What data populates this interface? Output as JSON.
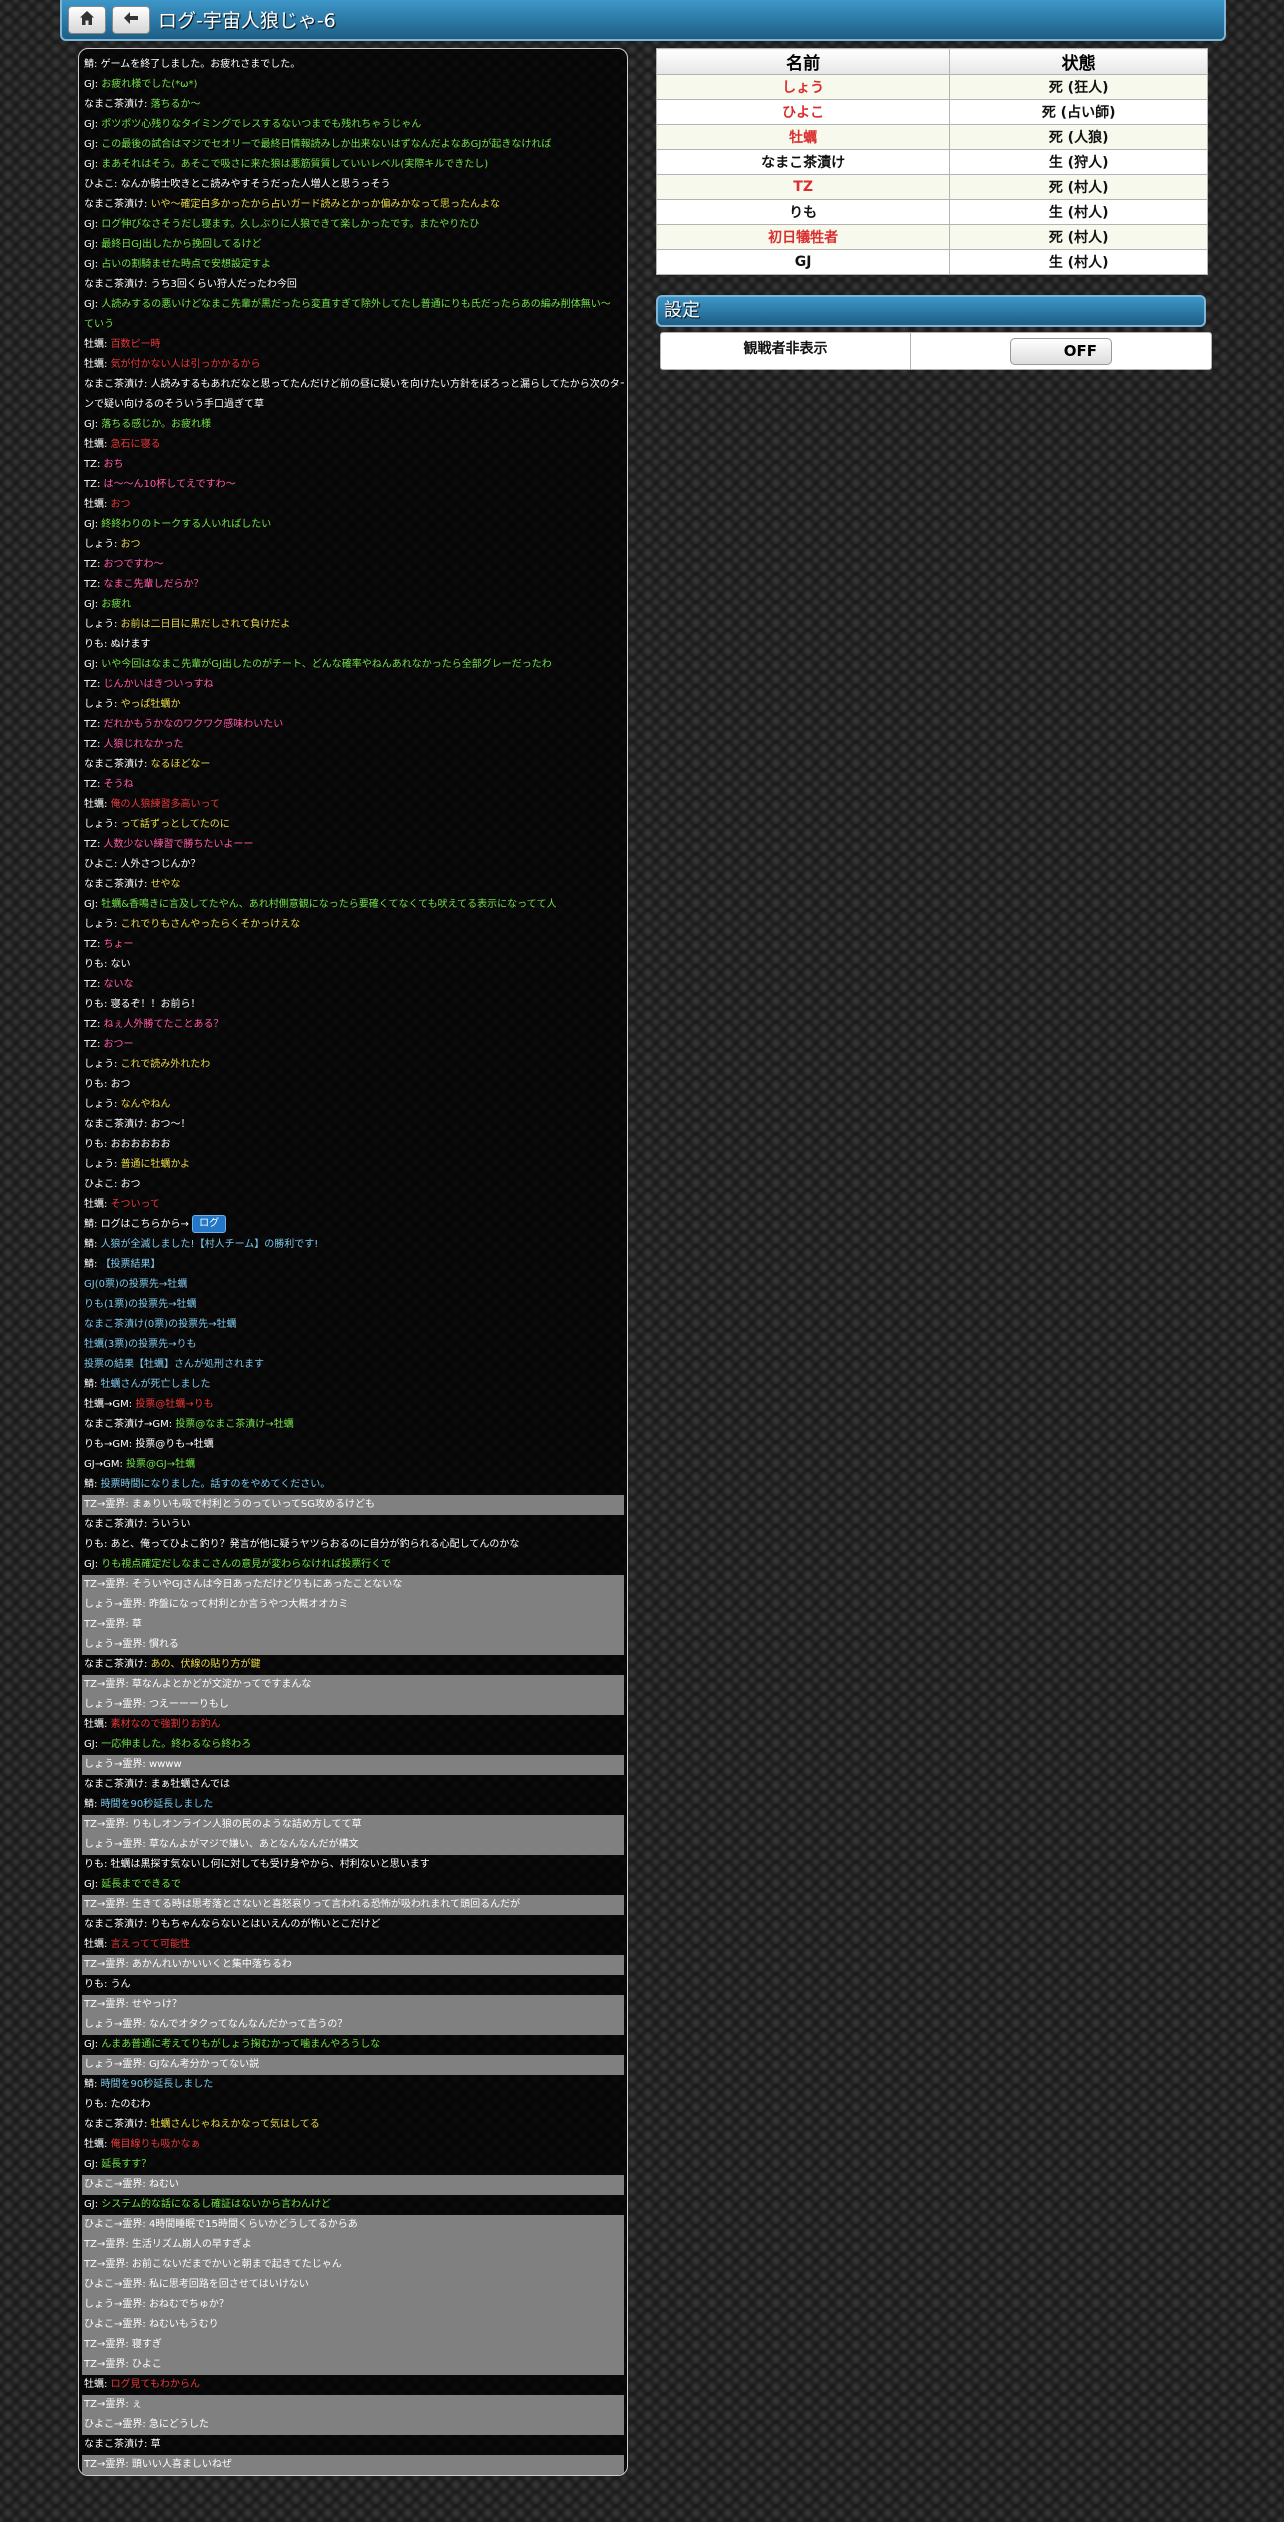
{
  "header": {
    "title": "ログ-宇宙人狼じゃ-6",
    "home_icon": "home-icon",
    "back_icon": "back-arrow-icon"
  },
  "status": {
    "columns": [
      "名前",
      "状態"
    ],
    "rows": [
      {
        "name": "しょう",
        "state": "死 (狂人)",
        "red": true
      },
      {
        "name": "ひよこ",
        "state": "死 (占い師)",
        "red": true
      },
      {
        "name": "牡蠣",
        "state": "死 (人狼)",
        "red": true
      },
      {
        "name": "なまこ茶漬け",
        "state": "生 (狩人)",
        "red": false
      },
      {
        "name": "TZ",
        "state": "死 (村人)",
        "red": true
      },
      {
        "name": "りも",
        "state": "生 (村人)",
        "red": false
      },
      {
        "name": "初日犠牲者",
        "state": "死 (村人)",
        "red": true
      },
      {
        "name": "GJ",
        "state": "生 (村人)",
        "red": false
      }
    ]
  },
  "settings": {
    "title": "設定",
    "label": "観戦者非表示",
    "toggle": "OFF"
  },
  "log_button": "ログ",
  "log": [
    {
      "s": "鯖: ",
      "t": "ゲームを終了しました。お疲れさまでした。",
      "c": "w"
    },
    {
      "s": "GJ: ",
      "t": "お疲れ様でした(*ω*)",
      "c": "g"
    },
    {
      "s": "なまこ茶漬け: ",
      "t": "落ちるか～",
      "c": "g"
    },
    {
      "s": "GJ: ",
      "t": "ポツポツ心残りなタイミングでレスするないつまでも残れちゃうじゃん",
      "c": "g"
    },
    {
      "s": "GJ: ",
      "t": "この最後の試合はマジでセオリーで最終日情報読みしか出来ないはずなんだよなあGJが起きなければ",
      "c": "g"
    },
    {
      "s": "GJ: ",
      "t": "まあそれはそう。あそこで吸さに来た狼は悪筋質質していいレベル(実際キルできたし)",
      "c": "g"
    },
    {
      "s": "ひよこ: ",
      "t": "なんか騎士吹きとこ読みやすそうだった人増人と思うっそう",
      "c": "w"
    },
    {
      "s": "なまこ茶漬け: ",
      "t": "いや～確定白多かったから占いガード読みとかっか偏みかなって思ったんよな",
      "c": "y"
    },
    {
      "s": "GJ: ",
      "t": "ログ伸びなさそうだし寝ます。久しぶりに人狼できて楽しかったです。またやりたひ",
      "c": "g"
    },
    {
      "s": "GJ: ",
      "t": "最終日GJ出したから挽回してるけど",
      "c": "g"
    },
    {
      "s": "GJ: ",
      "t": "占いの割騎ませた時点で安想設定すよ",
      "c": "g"
    },
    {
      "s": "なまこ茶漬け: ",
      "t": "うち3回くらい狩人だったわ今回",
      "c": "w"
    },
    {
      "s": "GJ: ",
      "t": "人読みするの悪いけどなまこ先輩が黒だったら変直すぎて除外してたし普通にりも氏だったらあの編み削体無い～",
      "c": "g"
    },
    {
      "s": "",
      "t": "ていう",
      "c": "g"
    },
    {
      "s": "牡蠣: ",
      "t": "百数ピー時",
      "c": "r"
    },
    {
      "s": "牡蠣: ",
      "t": "気が付かない人は引っかかるから",
      "c": "r"
    },
    {
      "s": "なまこ茶漬け: ",
      "t": "人読みするもあれだなと思ってたんだけど前の昼に疑いを向けたい方針をぼろっと漏らしてたから次のター",
      "c": "w"
    },
    {
      "s": "",
      "t": "ンで疑い向けるのそういう手口過ぎて草",
      "c": "w"
    },
    {
      "s": "GJ: ",
      "t": "落ちる感じか。お疲れ様",
      "c": "g"
    },
    {
      "s": "牡蠣: ",
      "t": "急石に寝る",
      "c": "r"
    },
    {
      "s": "TZ: ",
      "t": "おち",
      "c": "p"
    },
    {
      "s": "TZ: ",
      "t": "は～～ん10杯してえですわ～",
      "c": "p"
    },
    {
      "s": "牡蠣: ",
      "t": "おつ",
      "c": "r"
    },
    {
      "s": "GJ: ",
      "t": "終終わりのトークする人いればしたい",
      "c": "g"
    },
    {
      "s": "しょう: ",
      "t": "おつ",
      "c": "y"
    },
    {
      "s": "TZ: ",
      "t": "おつですわ～",
      "c": "p"
    },
    {
      "s": "TZ: ",
      "t": "なまこ先輩しだらか？",
      "c": "p"
    },
    {
      "s": "GJ: ",
      "t": "お疲れ",
      "c": "g"
    },
    {
      "s": "しょう: ",
      "t": "お前は二日目に黒だしされて負けだよ",
      "c": "y"
    },
    {
      "s": "りも: ",
      "t": "ぬけます",
      "c": "w"
    },
    {
      "s": "GJ: ",
      "t": "いや今回はなまこ先輩がGJ出したのがチート、どんな確率やねんあれなかったら全部グレーだったわ",
      "c": "g"
    },
    {
      "s": "TZ: ",
      "t": "じんかいはきついっすね",
      "c": "p"
    },
    {
      "s": "しょう: ",
      "t": "やっぱ牡蠣か",
      "c": "y"
    },
    {
      "s": "TZ: ",
      "t": "だれかもうかなのワクワク感味わいたい",
      "c": "p"
    },
    {
      "s": "TZ: ",
      "t": "人狼じれなかった",
      "c": "p"
    },
    {
      "s": "なまこ茶漬け: ",
      "t": "なるほどなー",
      "c": "y"
    },
    {
      "s": "TZ: ",
      "t": "そうね",
      "c": "p"
    },
    {
      "s": "牡蠣: ",
      "t": "俺の人狼練習多高いって",
      "c": "r"
    },
    {
      "s": "しょう: ",
      "t": "って話ずっとしてたのに",
      "c": "y"
    },
    {
      "s": "TZ: ",
      "t": "人数少ない練習で勝ちたいよーー",
      "c": "p"
    },
    {
      "s": "ひよこ: ",
      "t": "人外さつじんか？",
      "c": "w"
    },
    {
      "s": "なまこ茶漬け: ",
      "t": "せやな",
      "c": "y"
    },
    {
      "s": "GJ: ",
      "t": "牡蠣&香鳴きに言及してたやん、あれ村側意観になったら要確くてなくても吠えてる表示になってて人",
      "c": "g"
    },
    {
      "s": "しょう: ",
      "t": "これでりもさんやったらくそかっけえな",
      "c": "y"
    },
    {
      "s": "TZ: ",
      "t": "ちょー",
      "c": "p"
    },
    {
      "s": "りも: ",
      "t": "ない",
      "c": "w"
    },
    {
      "s": "TZ: ",
      "t": "ないな",
      "c": "p"
    },
    {
      "s": "りも: ",
      "t": "寝るぞ！！お前ら！",
      "c": "w"
    },
    {
      "s": "TZ: ",
      "t": "ねぇ人外勝てたことある？",
      "c": "p"
    },
    {
      "s": "TZ: ",
      "t": "おつー",
      "c": "p"
    },
    {
      "s": "しょう: ",
      "t": "これで読み外れたわ",
      "c": "y"
    },
    {
      "s": "りも: ",
      "t": "おつ",
      "c": "w"
    },
    {
      "s": "しょう: ",
      "t": "なんやねん",
      "c": "y"
    },
    {
      "s": "なまこ茶漬け: ",
      "t": "おつ～！",
      "c": "w"
    },
    {
      "s": "りも: ",
      "t": "おおおおおお",
      "c": "w"
    },
    {
      "s": "しょう: ",
      "t": "普通に牡蠣かよ",
      "c": "y"
    },
    {
      "s": "ひよこ: ",
      "t": "おつ",
      "c": "w"
    },
    {
      "s": "牡蠣: ",
      "t": "そついって",
      "c": "r"
    },
    {
      "s": "鯖: ",
      "t": "ログはこちらから→",
      "c": "w",
      "btn": true
    },
    {
      "s": "鯖: ",
      "t": "人狼が全滅しました!【村人チーム】の勝利です!",
      "c": "b"
    },
    {
      "s": "鯖: ",
      "t": "【投票結果】",
      "c": "b"
    },
    {
      "s": "",
      "t": "GJ(0票)の投票先→牡蠣",
      "c": "b"
    },
    {
      "s": "",
      "t": "りも(1票)の投票先→牡蠣",
      "c": "b"
    },
    {
      "s": "",
      "t": "なまこ茶漬け(0票)の投票先→牡蠣",
      "c": "b"
    },
    {
      "s": "",
      "t": "牡蠣(3票)の投票先→りも",
      "c": "b"
    },
    {
      "s": "",
      "t": "投票の結果【牡蠣】さんが処刑されます",
      "c": "b"
    },
    {
      "s": "鯖: ",
      "t": "牡蠣さんが死亡しました",
      "c": "b"
    },
    {
      "s": "牡蠣→GM: ",
      "t": "投票@牡蠣→りも",
      "c": "r"
    },
    {
      "s": "なまこ茶漬け→GM: ",
      "t": "投票@なまこ茶漬け→牡蠣",
      "c": "g"
    },
    {
      "s": "りも→GM: ",
      "t": "投票@りも→牡蠣",
      "c": "w"
    },
    {
      "s": "GJ→GM: ",
      "t": "投票@GJ→牡蠣",
      "c": "g"
    },
    {
      "s": "鯖: ",
      "t": "投票時間になりました。話すのをやめてください。",
      "c": "b"
    },
    {
      "s": "TZ→霊界: ",
      "t": "まぁりいも吸で村利とうのっていってSG攻めるけども",
      "c": "w",
      "grey": true
    },
    {
      "s": "なまこ茶漬け: ",
      "t": "ういうい",
      "c": "w"
    },
    {
      "s": "りも: ",
      "t": "あと、俺ってひよこ釣り？発言が他に疑うヤツらおるのに自分が釣られる心配してんのかな",
      "c": "w"
    },
    {
      "s": "GJ: ",
      "t": "りも視点確定だしなまこさんの意見が変わらなければ投票行くで",
      "c": "g"
    },
    {
      "s": "TZ→霊界: ",
      "t": "そういやGJさんは今日あっただけどりもにあったことないな",
      "c": "w",
      "grey": true
    },
    {
      "s": "しょう→霊界: ",
      "t": "昨盤になって村利とか言うやつ大概オオカミ",
      "c": "w",
      "grey": true
    },
    {
      "s": "TZ→霊界: ",
      "t": "草",
      "c": "w",
      "grey": true
    },
    {
      "s": "しょう→霊界: ",
      "t": "慣れる",
      "c": "w",
      "grey": true
    },
    {
      "s": "なまこ茶漬け: ",
      "t": "あの、伏線の貼り方が鍵",
      "c": "y"
    },
    {
      "s": "TZ→霊界: ",
      "t": "草なんよとかどが文淀かってですまんな",
      "c": "w",
      "grey": true
    },
    {
      "s": "しょう→霊界: ",
      "t": "つえーーーりもし",
      "c": "w",
      "grey": true
    },
    {
      "s": "牡蠣: ",
      "t": "素材なので強割りお釣ん",
      "c": "r"
    },
    {
      "s": "GJ: ",
      "t": "一応伸ました。終わるなら終わろ",
      "c": "g"
    },
    {
      "s": "しょう→霊界: ",
      "t": "wwww",
      "c": "w",
      "grey": true
    },
    {
      "s": "なまこ茶漬け: ",
      "t": "まぁ牡蠣さんでは",
      "c": "w"
    },
    {
      "s": "鯖: ",
      "t": "時間を90秒延長しました",
      "c": "b"
    },
    {
      "s": "TZ→霊界: ",
      "t": "りもしオンライン人狼の民のような詰め方してて草",
      "c": "w",
      "grey": true
    },
    {
      "s": "しょう→霊界: ",
      "t": "草なんよがマジで嫌い、あとなんなんだが構文",
      "c": "w",
      "grey": true
    },
    {
      "s": "りも: ",
      "t": "牡蠣は黒探す気ないし何に対しても受け身やから、村利ないと思います",
      "c": "w"
    },
    {
      "s": "GJ: ",
      "t": "延長までできるで",
      "c": "g"
    },
    {
      "s": "TZ→霊界: ",
      "t": "生きてる時は思考落とさないと喜怒哀りって言われる恐怖が吸われまれて頭回るんだが",
      "c": "w",
      "grey": true
    },
    {
      "s": "なまこ茶漬け: ",
      "t": "りもちゃんならないとはいえんのが怖いとこだけど",
      "c": "w"
    },
    {
      "s": "牡蠣: ",
      "t": "言えってて可能性",
      "c": "r"
    },
    {
      "s": "TZ→霊界: ",
      "t": "あかんれいかいいくと集中落ちるわ",
      "c": "w",
      "grey": true
    },
    {
      "s": "りも: ",
      "t": "うん",
      "c": "w"
    },
    {
      "s": "TZ→霊界: ",
      "t": "せやっけ？",
      "c": "w",
      "grey": true
    },
    {
      "s": "しょう→霊界: ",
      "t": "なんでオタクってなんなんだかって言うの？",
      "c": "w",
      "grey": true
    },
    {
      "s": "GJ: ",
      "t": "んまあ普通に考えてりもがしょう掬むかって噛まんやろうしな",
      "c": "g"
    },
    {
      "s": "しょう→霊界: ",
      "t": "GJなん考分かってない説",
      "c": "w",
      "grey": true
    },
    {
      "s": "鯖: ",
      "t": "時間を90秒延長しました",
      "c": "b"
    },
    {
      "s": "りも: ",
      "t": "たのむわ",
      "c": "w"
    },
    {
      "s": "なまこ茶漬け: ",
      "t": "牡蠣さんじゃねえかなって気はしてる",
      "c": "y"
    },
    {
      "s": "牡蠣: ",
      "t": "俺目線りも吸かなぁ",
      "c": "r"
    },
    {
      "s": "GJ: ",
      "t": "延長すす？",
      "c": "g"
    },
    {
      "s": "ひよこ→霊界: ",
      "t": "ねむい",
      "c": "w",
      "grey": true
    },
    {
      "s": "GJ: ",
      "t": "システム的な話になるし確証はないから言わんけど",
      "c": "g"
    },
    {
      "s": "ひよこ→霊界: ",
      "t": "4時間睡眠で15時間くらいかどうしてるからあ",
      "c": "w",
      "grey": true
    },
    {
      "s": "TZ→霊界: ",
      "t": "生活リズム崩人の早すぎよ",
      "c": "w",
      "grey": true
    },
    {
      "s": "TZ→霊界: ",
      "t": "お前こないだまでかいと朝まで起きてたじゃん",
      "c": "w",
      "grey": true
    },
    {
      "s": "ひよこ→霊界: ",
      "t": "私に思考回路を回させてはいけない",
      "c": "w",
      "grey": true
    },
    {
      "s": "しょう→霊界: ",
      "t": "おねむでちゅか？",
      "c": "w",
      "grey": true
    },
    {
      "s": "ひよこ→霊界: ",
      "t": "ねむいもうむり",
      "c": "w",
      "grey": true
    },
    {
      "s": "TZ→霊界: ",
      "t": "寝すぎ",
      "c": "w",
      "grey": true
    },
    {
      "s": "TZ→霊界: ",
      "t": "ひよこ",
      "c": "w",
      "grey": true
    },
    {
      "s": "牡蠣: ",
      "t": "ログ見てもわからん",
      "c": "r"
    },
    {
      "s": "TZ→霊界: ",
      "t": "ぇ",
      "c": "w",
      "grey": true
    },
    {
      "s": "ひよこ→霊界: ",
      "t": "急にどうした",
      "c": "w",
      "grey": true
    },
    {
      "s": "なまこ茶漬け: ",
      "t": "草",
      "c": "w"
    },
    {
      "s": "TZ→霊界: ",
      "t": "頭いい人喜ましいねぜ",
      "c": "w",
      "grey": true
    }
  ]
}
